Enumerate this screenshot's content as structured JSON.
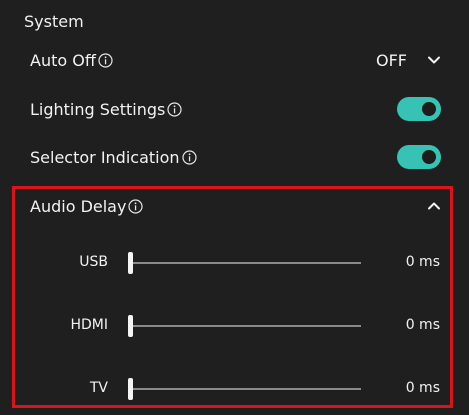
{
  "section": {
    "title": "System"
  },
  "auto_off": {
    "label": "Auto Off",
    "value": "OFF"
  },
  "lighting": {
    "label": "Lighting Settings",
    "enabled": true
  },
  "selector": {
    "label": "Selector Indication",
    "enabled": true
  },
  "audio_delay": {
    "label": "Audio Delay",
    "expanded": true,
    "sliders": [
      {
        "label": "USB",
        "value": "0 ms",
        "level": 0
      },
      {
        "label": "HDMI",
        "value": "0 ms",
        "level": 0
      },
      {
        "label": "TV",
        "value": "0 ms",
        "level": 0
      }
    ]
  },
  "colors": {
    "background": "#1f1f1f",
    "toggle_on": "#36c3b4",
    "highlight_border": "#d9141a"
  },
  "icons": {
    "info": "info-icon",
    "dropdown": "chevron-down-icon",
    "collapse": "chevron-up-icon"
  }
}
